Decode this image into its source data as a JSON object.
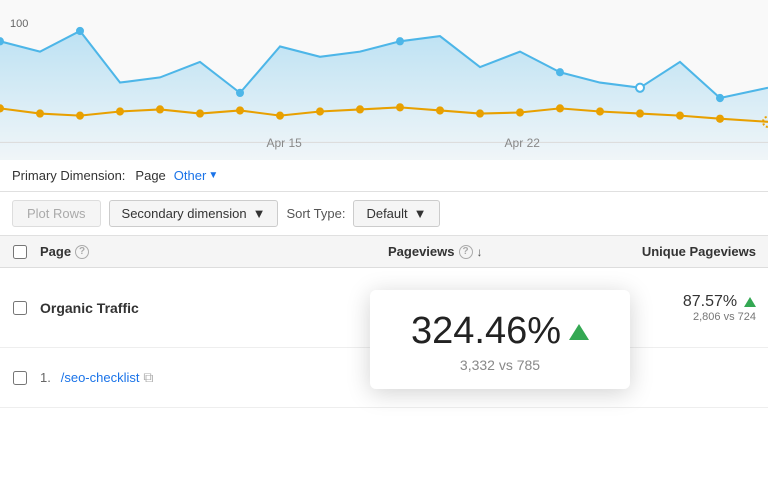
{
  "chart": {
    "y_label_100": "100",
    "label_apr15": "Apr 15",
    "label_apr22": "Apr 22"
  },
  "primary_dimension": {
    "label": "Primary Dimension:",
    "page_label": "Page",
    "other_label": "Other"
  },
  "toolbar": {
    "plot_rows_label": "Plot Rows",
    "secondary_dim_label": "Secondary dimension",
    "sort_type_label": "Sort Type:",
    "default_label": "Default"
  },
  "table": {
    "headers": {
      "page": "Page",
      "pageviews": "Pageviews",
      "unique_pageviews": "Unique Pageviews"
    },
    "rows": [
      {
        "id": "organic-traffic",
        "page": "Organic Traffic",
        "bold": true,
        "pageviews_pct": "324.46%",
        "pageviews_sub": "3,332 vs 785",
        "unique_pct": "87.57%",
        "unique_sub": "2,806 vs 724"
      },
      {
        "id": "seo-checklist",
        "number": "1.",
        "page": "/seo-checklist",
        "bold": false
      }
    ]
  },
  "tooltip": {
    "main_value": "324.46%",
    "sub_value": "3,332 vs 785"
  }
}
